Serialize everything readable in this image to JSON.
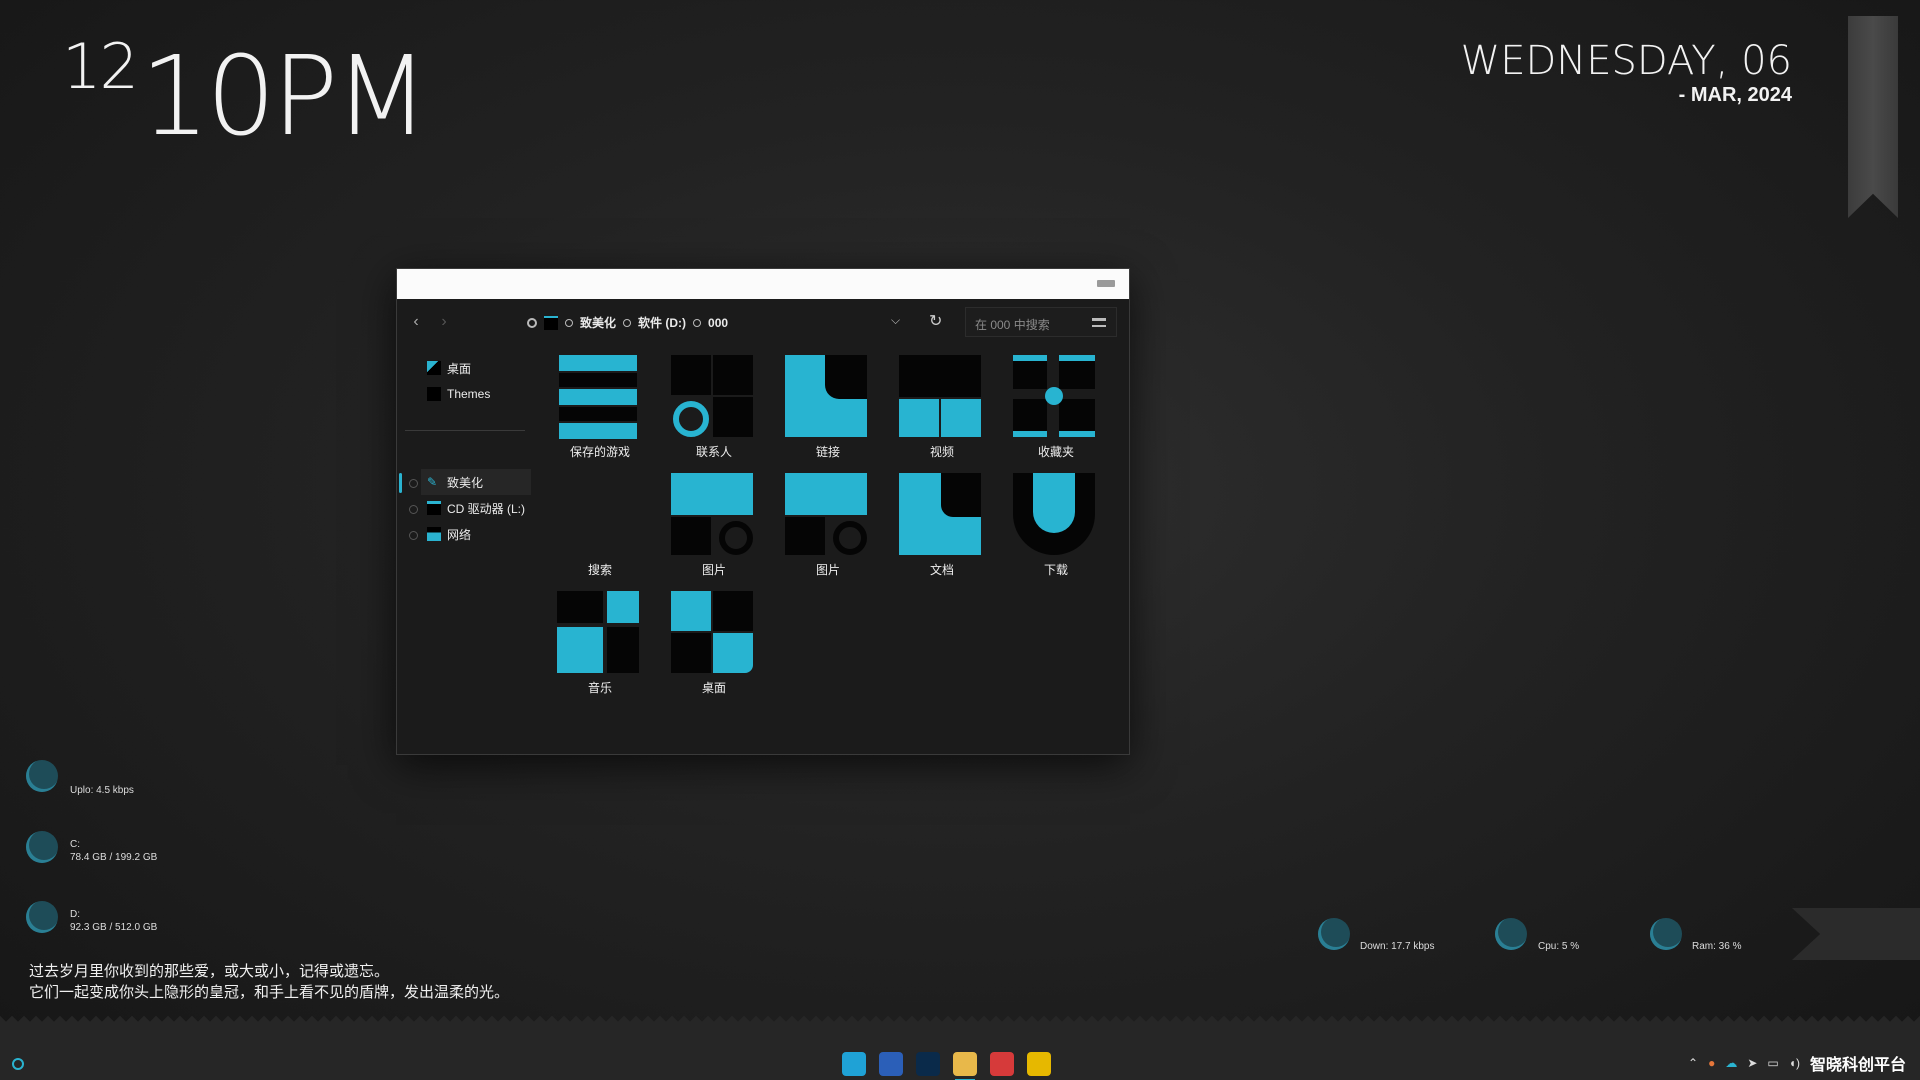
{
  "clock": {
    "hour": "12",
    "minute": "10PM"
  },
  "date": {
    "weekday": "WEDNESDAY, 06",
    "month_year": "- MAR, 2024"
  },
  "explorer": {
    "breadcrumb": [
      "致美化",
      "软件 (D:)",
      "000"
    ],
    "search_placeholder": "在 000 中搜索",
    "sidebar_pinned": [
      {
        "label": "桌面",
        "icon": "desktop-icon"
      },
      {
        "label": "Themes",
        "icon": "folder-icon"
      }
    ],
    "sidebar_tree": [
      {
        "label": "致美化",
        "icon": "brush-icon",
        "selected": true
      },
      {
        "label": "CD 驱动器 (L:)",
        "icon": "cd-drive-icon"
      },
      {
        "label": "网络",
        "icon": "network-icon"
      }
    ],
    "folders": [
      "保存的游戏",
      "联系人",
      "链接",
      "视频",
      "收藏夹",
      "搜索",
      "图片",
      "图片",
      "文档",
      "下载",
      "音乐",
      "桌面"
    ]
  },
  "stats_left": {
    "upload": "Uplo: 4.5 kbps",
    "c_drive_label": "C:",
    "c_drive_value": "78.4 GB / 199.2 GB",
    "d_drive_label": "D:",
    "d_drive_value": "92.3 GB / 512.0 GB"
  },
  "stats_right": {
    "down": "Down: 17.7 kbps",
    "cpu": "Cpu: 5 %",
    "ram": "Ram: 36 %"
  },
  "quote": {
    "line1": "过去岁月里你收到的那些爱，或大或小，记得或遗忘。",
    "line2": "它们一起变成你头上隐形的皇冠，和手上看不见的盾牌，发出温柔的光。"
  },
  "taskbar": {
    "apps": [
      {
        "icon": "edge-icon",
        "color": "#1fa2d6"
      },
      {
        "icon": "word-icon",
        "color": "#2b5fb8"
      },
      {
        "icon": "photoshop-icon",
        "color": "#0a2a4a"
      },
      {
        "icon": "file-explorer-icon",
        "color": "#e8b84a",
        "active": true
      },
      {
        "icon": "netease-music-icon",
        "color": "#d63a3a"
      },
      {
        "icon": "chrome-icon",
        "color": "#e6b800"
      }
    ],
    "watermark": "智晓科创平台"
  },
  "colors": {
    "accent": "#2ab3d0",
    "window_bg": "#1b1b1b",
    "desktop": "#222222"
  }
}
